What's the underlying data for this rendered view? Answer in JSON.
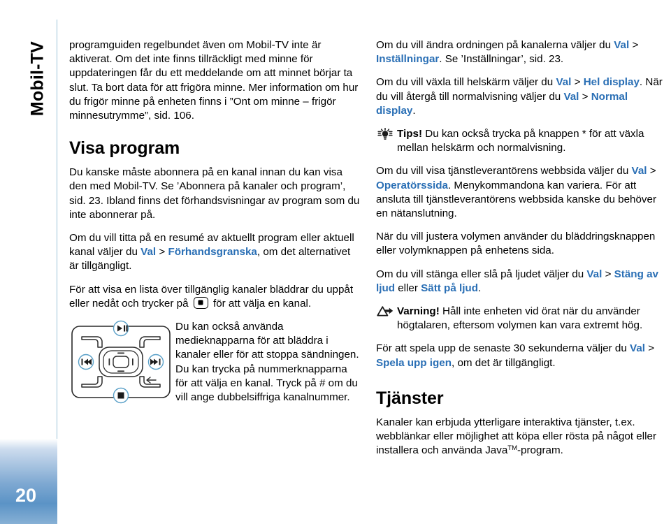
{
  "document": {
    "chapter_tab": "Mobil-TV",
    "page_number": "20",
    "link_color": "#2a6fb5",
    "rule_color": "#9cc4d8"
  },
  "left_column": {
    "intro_paragraph": "programguiden regelbundet även om Mobil-TV inte är aktiverat. Om det inte finns tillräckligt med minne för uppdateringen får du ett meddelande om att minnet börjar ta slut. Ta bort data för att frigöra minne. Mer information om hur du frigör minne på enheten finns i ”Ont om minne – frigör minnesutrymme”, sid. 106.",
    "heading": "Visa program",
    "paragraph_1": "Du kanske måste abonnera på en kanal innan du kan visa den med Mobil-TV. Se ’Abonnera på kanaler och program’, sid. 23. Ibland finns det förhandsvisningar av program som du inte abonnerar på.",
    "paragraph_2_a": "Om du vill titta på en resumé av aktuellt program eller aktuell kanal väljer du ",
    "paragraph_2_link_1": "Val",
    "paragraph_2_sep": " > ",
    "paragraph_2_link_2": "Förhandsgranska",
    "paragraph_2_b": ", om det alternativet är tillgängligt.",
    "paragraph_3_a": "För att visa en lista över tillgänglig kanaler bläddrar du uppåt eller nedåt och trycker på ",
    "paragraph_3_b": " för att välja en kanal.",
    "figure_caption": "Du kan också använda medieknapparna för att bläddra i kanaler eller för att stoppa sändningen. Du kan trycka på nummerknapparna för att välja en kanal. Tryck på # om du vill ange dubbelsiffriga kanalnummer.",
    "device_figure": {
      "name": "media-keys-diagram",
      "keys": [
        "left-softkey",
        "play-pause-key",
        "right-softkey",
        "rewind-key",
        "scroll-key",
        "forward-key",
        "menu-key",
        "stop-key",
        "clear-key"
      ]
    }
  },
  "right_column": {
    "paragraph_1_a": "Om du vill ändra ordningen på kanalerna väljer du ",
    "paragraph_1_link_1": "Val",
    "paragraph_1_sep": " > ",
    "paragraph_1_link_2": "Inställningar",
    "paragraph_1_b": ". Se ’Inställningar’, sid. 23.",
    "paragraph_2_a": "Om du vill växla till helskärm väljer du ",
    "paragraph_2_link_1": "Val",
    "paragraph_2_link_2": "Hel display",
    "paragraph_2_b": ". När du vill återgå till normalvisning väljer du ",
    "paragraph_2_link_3": "Val",
    "paragraph_2_link_4": "Normal display",
    "paragraph_2_c": ".",
    "tip": {
      "icon": "lightbulb-icon",
      "label": "Tips!",
      "text": " Du kan också trycka på knappen * för att växla mellan helskärm och normalvisning."
    },
    "paragraph_3_a": "Om du vill visa tjänstleverantörens webbsida väljer du ",
    "paragraph_3_link_1": "Val",
    "paragraph_3_link_2": "Operatörssida",
    "paragraph_3_b": ". Menykommandona kan variera. För att ansluta till tjänstleverantörens webbsida kanske du behöver en nätanslutning.",
    "paragraph_4": "När du vill justera volymen använder du bläddringsknappen eller volymknappen på enhetens sida.",
    "paragraph_5_a": "Om du vill stänga eller slå på ljudet väljer du ",
    "paragraph_5_link_1": "Val",
    "paragraph_5_link_2": "Stäng av ljud",
    "paragraph_5_mid": " eller ",
    "paragraph_5_link_3": "Sätt på ljud",
    "paragraph_5_b": ".",
    "warning": {
      "icon": "warning-triangle-icon",
      "label": "Varning!",
      "text": " Håll inte enheten vid örat när du använder högtalaren, eftersom volymen kan vara extremt hög."
    },
    "paragraph_6_a": "För att spela upp de senaste 30 sekunderna väljer du ",
    "paragraph_6_link_1": "Val",
    "paragraph_6_link_2": "Spela upp igen",
    "paragraph_6_b": ", om det är tillgängligt.",
    "heading": "Tjänster",
    "paragraph_7_a": "Kanaler kan erbjuda ytterligare interaktiva tjänster, t.ex. webblänkar eller möjlighet att köpa eller rösta på något eller installera och använda Java",
    "paragraph_7_tm": "TM",
    "paragraph_7_b": "-program."
  }
}
